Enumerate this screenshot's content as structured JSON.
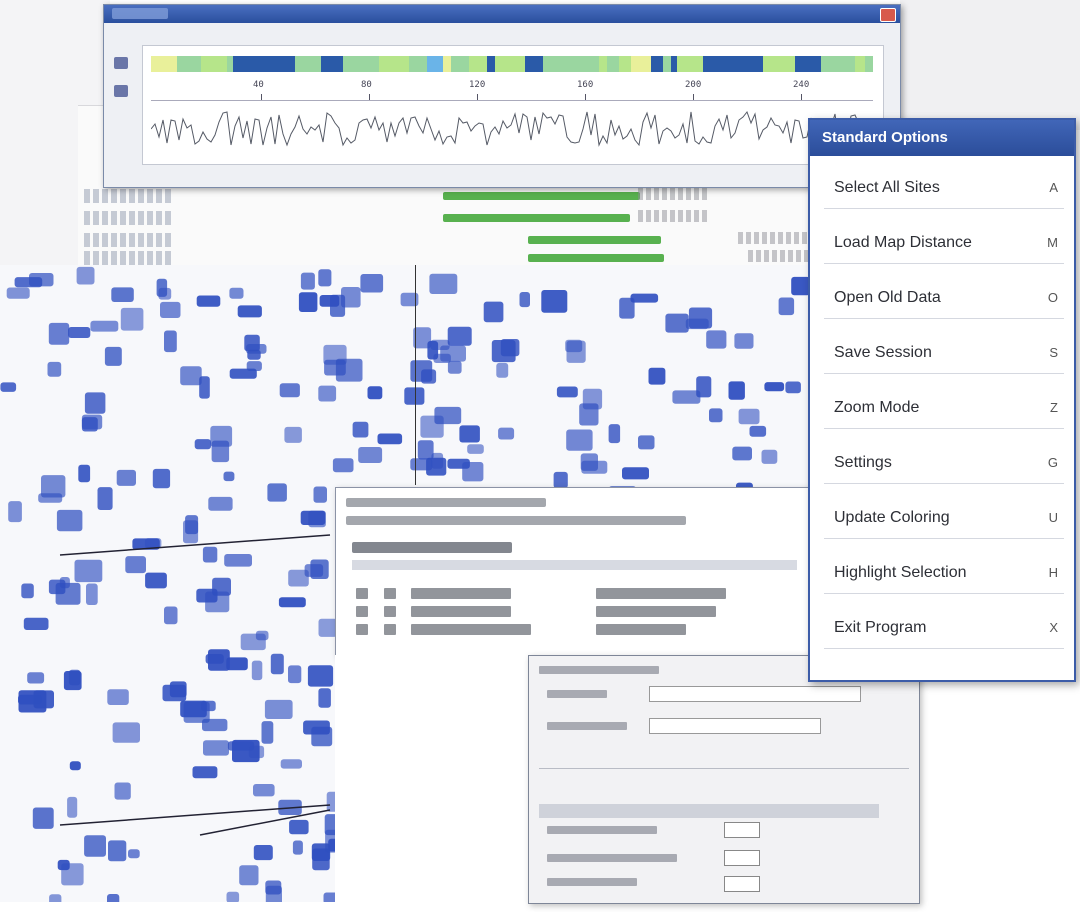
{
  "colors": {
    "titlebar": "#2a4f9e",
    "menu_border": "#3c5ca8",
    "dot": "#2f4fc0",
    "green_bar": "#58b14f",
    "track_colors": [
      "#9ad6a0",
      "#7fd0d8",
      "#b6e58a",
      "#6ab4e8",
      "#2a5aa8",
      "#e9f09a"
    ]
  },
  "alignment_window": {
    "ruler_numbers": [
      "40",
      "80",
      "120",
      "160",
      "200",
      "240"
    ]
  },
  "sequence_list": {
    "bars": [
      0.58,
      0.55,
      0.39,
      0.4
    ]
  },
  "context_menu": {
    "title": "Standard Options",
    "items": [
      {
        "label": "Select All Sites",
        "shortcut": "A"
      },
      {
        "label": "Load Map Distance",
        "shortcut": "M"
      },
      {
        "label": "Open Old Data",
        "shortcut": "O"
      },
      {
        "label": "Save Session",
        "shortcut": "S"
      },
      {
        "label": "Zoom Mode",
        "shortcut": "Z"
      },
      {
        "label": "Settings",
        "shortcut": "G"
      },
      {
        "label": "Update Coloring",
        "shortcut": "U"
      },
      {
        "label": "Highlight Selection",
        "shortcut": "H"
      },
      {
        "label": "Exit Program",
        "shortcut": "X"
      }
    ]
  }
}
